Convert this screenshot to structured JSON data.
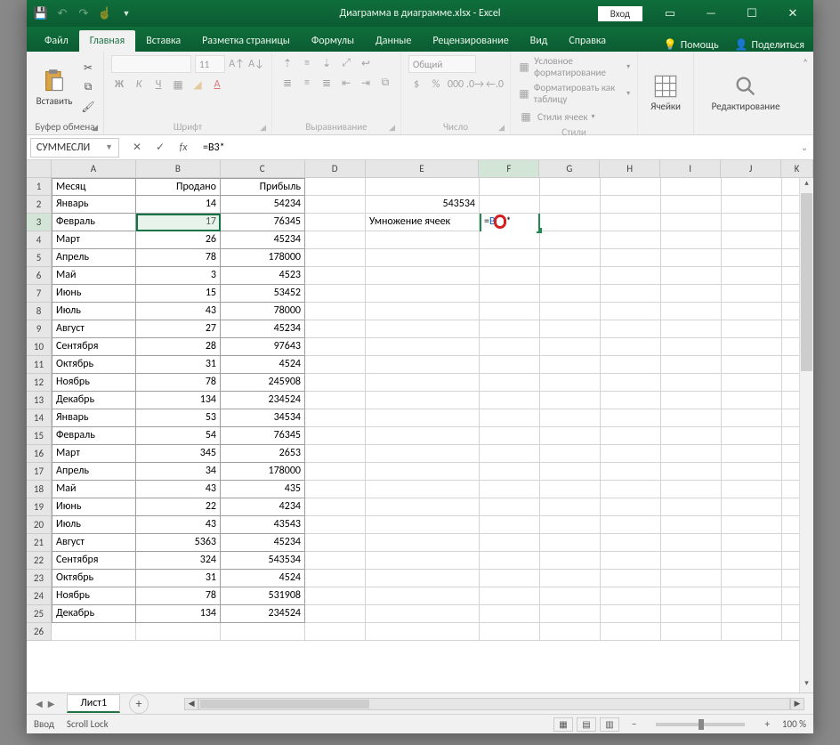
{
  "title": "Диаграмма в диаграмме.xlsx - Excel",
  "login": "Вход",
  "tabs": [
    "Файл",
    "Главная",
    "Вставка",
    "Разметка страницы",
    "Формулы",
    "Данные",
    "Рецензирование",
    "Вид",
    "Справка"
  ],
  "active_tab": "Главная",
  "help_label": "Помощь",
  "share_label": "Поделиться",
  "groups": {
    "clipboard": {
      "paste": "Вставить",
      "label": "Буфер обмена"
    },
    "font": {
      "label": "Шрифт",
      "size": "11"
    },
    "align": {
      "label": "Выравнивание"
    },
    "number": {
      "label": "Число",
      "format": "Общий"
    },
    "styles": {
      "label": "Стили",
      "cond": "Условное форматирование",
      "table": "Форматировать как таблицу",
      "cell": "Стили ячеек"
    },
    "cells": {
      "label": "Ячейки"
    },
    "editing": {
      "label": "Редактирование"
    }
  },
  "name_box": "СУММЕСЛИ",
  "formula": "=B3*",
  "columns": [
    "A",
    "B",
    "C",
    "D",
    "E",
    "F",
    "G",
    "H",
    "I",
    "J",
    "K"
  ],
  "headers": {
    "a": "Месяц",
    "b": "Продано",
    "c": "Прибыль"
  },
  "e2": "543534",
  "e3": "Умножение ячеек",
  "f3_display": "=B3*",
  "rows": [
    {
      "n": 2,
      "a": "Январь",
      "b": "14",
      "c": "54234"
    },
    {
      "n": 3,
      "a": "Февраль",
      "b": "17",
      "c": "76345"
    },
    {
      "n": 4,
      "a": "Март",
      "b": "26",
      "c": "45234"
    },
    {
      "n": 5,
      "a": "Апрель",
      "b": "78",
      "c": "178000"
    },
    {
      "n": 6,
      "a": "Май",
      "b": "3",
      "c": "4523"
    },
    {
      "n": 7,
      "a": "Июнь",
      "b": "15",
      "c": "53452"
    },
    {
      "n": 8,
      "a": "Июль",
      "b": "43",
      "c": "78000"
    },
    {
      "n": 9,
      "a": "Август",
      "b": "27",
      "c": "45234"
    },
    {
      "n": 10,
      "a": "Сентября",
      "b": "28",
      "c": "97643"
    },
    {
      "n": 11,
      "a": "Октябрь",
      "b": "31",
      "c": "4524"
    },
    {
      "n": 12,
      "a": "Ноябрь",
      "b": "78",
      "c": "245908"
    },
    {
      "n": 13,
      "a": "Декабрь",
      "b": "134",
      "c": "234524"
    },
    {
      "n": 14,
      "a": "Январь",
      "b": "53",
      "c": "34534"
    },
    {
      "n": 15,
      "a": "Февраль",
      "b": "54",
      "c": "76345"
    },
    {
      "n": 16,
      "a": "Март",
      "b": "345",
      "c": "2653"
    },
    {
      "n": 17,
      "a": "Апрель",
      "b": "34",
      "c": "178000"
    },
    {
      "n": 18,
      "a": "Май",
      "b": "43",
      "c": "435"
    },
    {
      "n": 19,
      "a": "Июнь",
      "b": "22",
      "c": "4234"
    },
    {
      "n": 20,
      "a": "Июль",
      "b": "43",
      "c": "43543"
    },
    {
      "n": 21,
      "a": "Август",
      "b": "5363",
      "c": "45234"
    },
    {
      "n": 22,
      "a": "Сентября",
      "b": "324",
      "c": "543534"
    },
    {
      "n": 23,
      "a": "Октябрь",
      "b": "31",
      "c": "4524"
    },
    {
      "n": 24,
      "a": "Ноябрь",
      "b": "78",
      "c": "531908"
    },
    {
      "n": 25,
      "a": "Декабрь",
      "b": "134",
      "c": "234524"
    }
  ],
  "sheet_tab": "Лист1",
  "status": {
    "mode": "Ввод",
    "scroll": "Scroll Lock",
    "zoom": "100 %"
  }
}
